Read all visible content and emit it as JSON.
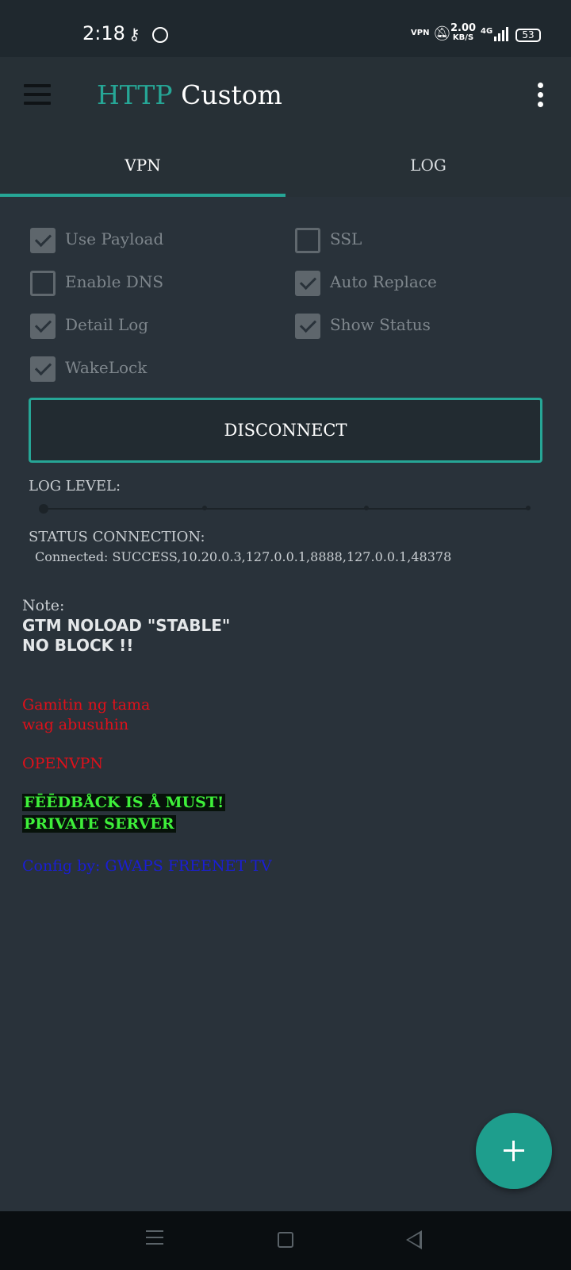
{
  "status_bar": {
    "time": "2:18",
    "vpn_badge": "VPN",
    "speed_value": "2.00",
    "speed_unit": "KB/S",
    "network": "4G",
    "battery": "53",
    "icons": [
      "key-icon",
      "smile-icon",
      "vpn-icon",
      "bell-off-icon",
      "signal-icon",
      "battery-icon"
    ]
  },
  "app_bar": {
    "title_accent": "HTTP",
    "title_rest": " Custom",
    "icons": [
      "menu-icon",
      "more-vert-icon"
    ]
  },
  "tabs": [
    {
      "label": "VPN",
      "active": true
    },
    {
      "label": "LOG",
      "active": false
    }
  ],
  "options": [
    {
      "label": "Use Payload",
      "checked": true
    },
    {
      "label": "SSL",
      "checked": false
    },
    {
      "label": "Enable DNS",
      "checked": false
    },
    {
      "label": "Auto Replace",
      "checked": true
    },
    {
      "label": "Detail Log",
      "checked": true
    },
    {
      "label": "Show Status",
      "checked": true
    },
    {
      "label": "WakeLock",
      "checked": true
    }
  ],
  "disconnect_label": "DISCONNECT",
  "log_level": {
    "label": "LOG LEVEL:",
    "value": 0,
    "steps": 4
  },
  "status": {
    "label": "STATUS CONNECTION:",
    "value": "Connected: SUCCESS,10.20.0.3,127.0.0.1,8888,127.0.0.1,48378"
  },
  "note": {
    "label": "Note:",
    "lines": [
      "GTM NOLOAD \"STABLE\"",
      "NO BLOCK !!"
    ],
    "red_lines": [
      "Gamitin ng tama",
      "wag abusuhin",
      "OPENVPN"
    ],
    "green_lines": [
      "FĒĒDBÅCK IS Å MUST!",
      "PRIVATE SERVER"
    ],
    "blue_line": "Config by: GWAPS FREENET TV"
  },
  "colors": {
    "accent": "#26a696",
    "background": "#29323a",
    "red_text": "#e0101a",
    "green_text": "#3ef03a",
    "blue_text": "#1a1ed6"
  },
  "fab_icon": "plus-icon",
  "nav_icons": [
    "recent-apps-icon",
    "home-icon",
    "back-icon"
  ]
}
